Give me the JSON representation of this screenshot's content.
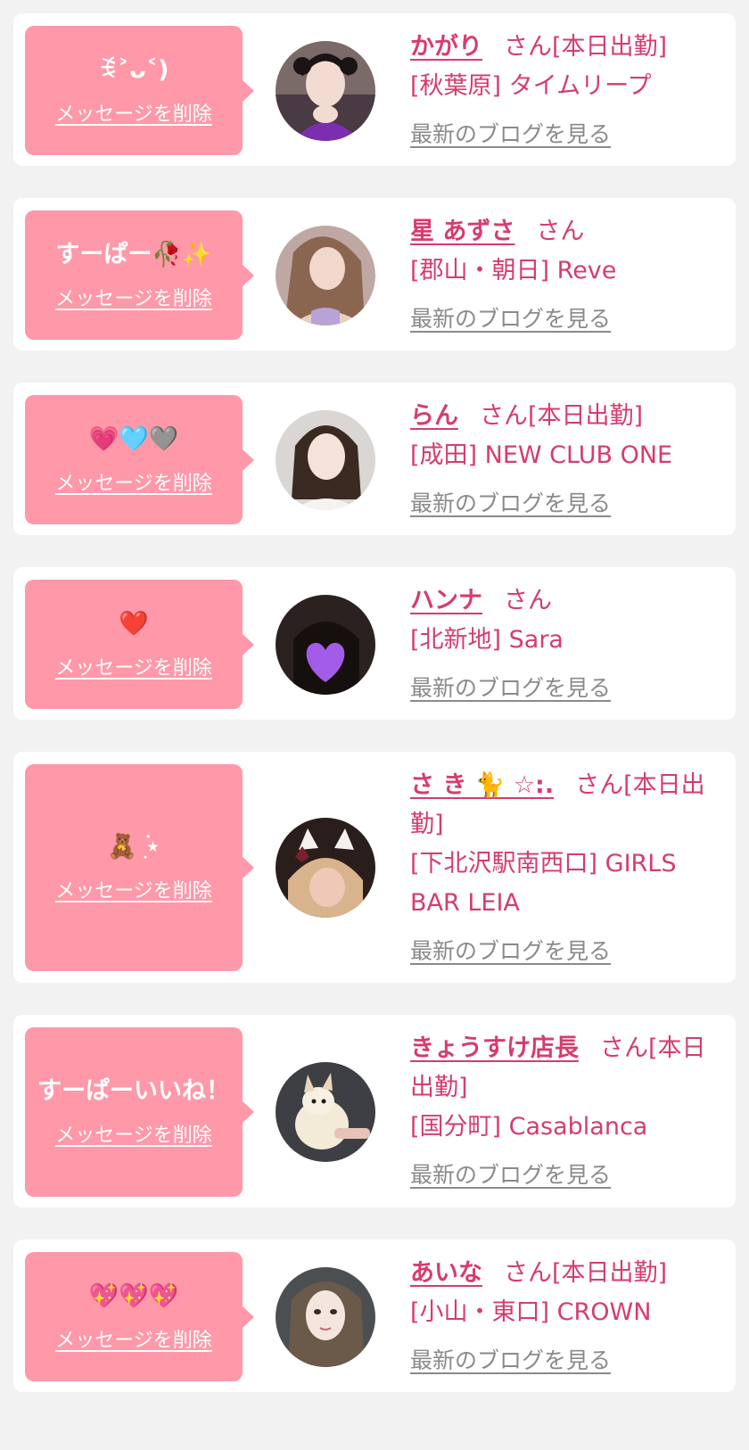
{
  "actions": {
    "delete_label": "メッセージを削除",
    "blog_label": "最新のブログを見る",
    "honorific": "さん"
  },
  "colors": {
    "bubble": "#ff98a8",
    "accent": "#d63c6c",
    "link_gray": "#8a8a8a",
    "background": "#f2f2f2"
  },
  "items": [
    {
      "message": "ꉂ˃ᴗ˂)",
      "name": "かがり",
      "suffix": "[本日出勤]",
      "shop": "[秋葉原] タイムリープ",
      "avatar": "avatar-photo"
    },
    {
      "message": "すーぱー🥀✨",
      "name": "星 あずさ",
      "suffix": "",
      "shop": "[郡山・朝日] Reve",
      "avatar": "avatar-photo"
    },
    {
      "message": "💗🩵🩶",
      "name": "らん",
      "suffix": "[本日出勤]",
      "shop": "[成田] NEW CLUB ONE",
      "avatar": "avatar-photo"
    },
    {
      "message": "❤️",
      "name": "ハンナ",
      "suffix": "",
      "shop": "[北新地] Sara",
      "avatar": "avatar-photo"
    },
    {
      "message": "🧸ִ ࣪⋆",
      "name": "さ き 🐈 ☆:.",
      "suffix": "[本日出勤]",
      "shop": "[下北沢駅南西口] GIRLS BAR LEIA",
      "avatar": "avatar-photo"
    },
    {
      "message": "すーぱーいいね！",
      "name": "きょうすけ店長",
      "suffix": "[本日出勤]",
      "shop": "[国分町] Casablanca",
      "avatar": "avatar-photo"
    },
    {
      "message": "💖💖💖",
      "name": "あいな",
      "suffix": "[本日出勤]",
      "shop": "[小山・東口] CROWN",
      "avatar": "avatar-photo"
    }
  ]
}
